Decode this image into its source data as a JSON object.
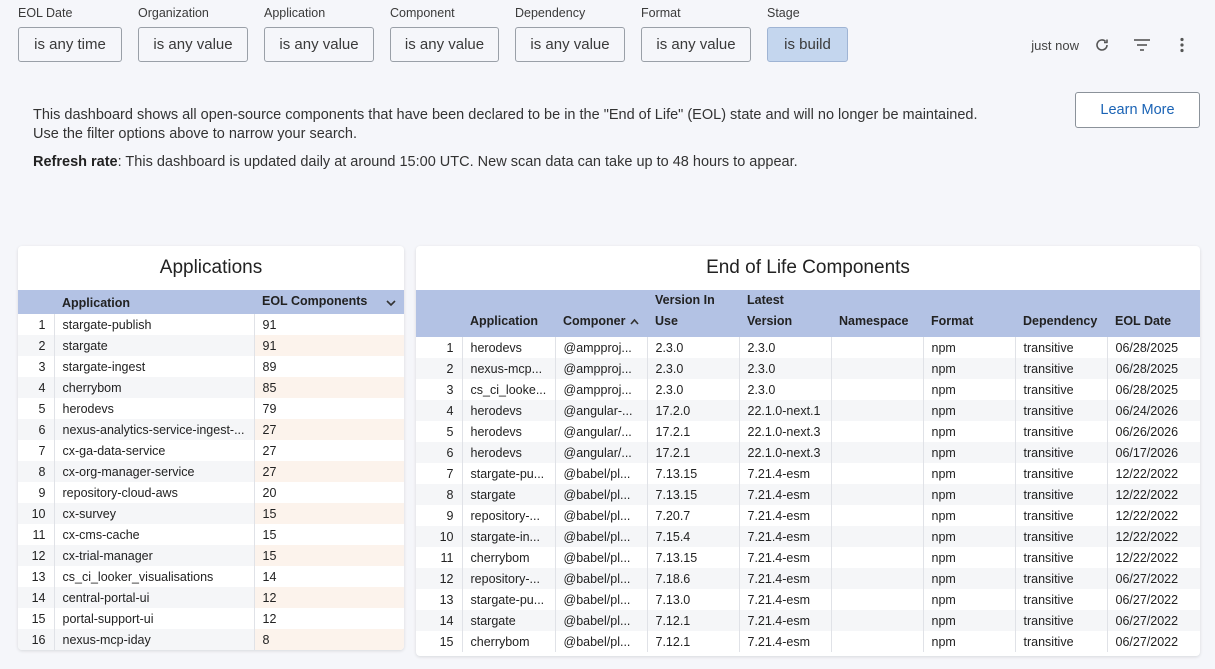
{
  "filters": [
    {
      "label": "EOL Date",
      "value": "is any time"
    },
    {
      "label": "Organization",
      "value": "is any value"
    },
    {
      "label": "Application",
      "value": "is any value"
    },
    {
      "label": "Component",
      "value": "is any value"
    },
    {
      "label": "Dependency",
      "value": "is any value"
    },
    {
      "label": "Format",
      "value": "is any value"
    },
    {
      "label": "Stage",
      "value": "is build"
    }
  ],
  "toolbar": {
    "updated": "just now",
    "refresh_icon": "refresh-icon",
    "filter_icon": "filter-lines-icon",
    "menu_icon": "more-vertical-icon"
  },
  "intro": {
    "line1": "This dashboard shows all open-source components that have been declared to be in the \"End of Life\" (EOL) state and will no longer be maintained.",
    "line2": "Use the filter options above to narrow your search.",
    "refresh_label": "Refresh rate",
    "refresh_text": ": This dashboard is updated daily at around 15:00 UTC. New scan data can take up to 48 hours to appear."
  },
  "learn_more": "Learn More",
  "applications": {
    "title": "Applications",
    "columns": [
      "Application",
      "EOL Components"
    ],
    "rows": [
      [
        "1",
        "stargate-publish",
        "91"
      ],
      [
        "2",
        "stargate",
        "91"
      ],
      [
        "3",
        "stargate-ingest",
        "89"
      ],
      [
        "4",
        "cherrybom",
        "85"
      ],
      [
        "5",
        "herodevs",
        "79"
      ],
      [
        "6",
        "nexus-analytics-service-ingest-...",
        "27"
      ],
      [
        "7",
        "cx-ga-data-service",
        "27"
      ],
      [
        "8",
        "cx-org-manager-service",
        "27"
      ],
      [
        "9",
        "repository-cloud-aws",
        "20"
      ],
      [
        "10",
        "cx-survey",
        "15"
      ],
      [
        "11",
        "cx-cms-cache",
        "15"
      ],
      [
        "12",
        "cx-trial-manager",
        "15"
      ],
      [
        "13",
        "cs_ci_looker_visualisations",
        "14"
      ],
      [
        "14",
        "central-portal-ui",
        "12"
      ],
      [
        "15",
        "portal-support-ui",
        "12"
      ],
      [
        "16",
        "nexus-mcp-iday",
        "8"
      ]
    ]
  },
  "eol": {
    "title": "End of Life Components",
    "columns": [
      "Application",
      "Componer",
      "Version In Use",
      "Latest Version",
      "Namespace",
      "Format",
      "Dependency",
      "EOL Date"
    ],
    "rows": [
      [
        "1",
        "herodevs",
        "@ampproj...",
        "2.3.0",
        "2.3.0",
        "",
        "npm",
        "transitive",
        "06/28/2025"
      ],
      [
        "2",
        "nexus-mcp...",
        "@ampproj...",
        "2.3.0",
        "2.3.0",
        "",
        "npm",
        "transitive",
        "06/28/2025"
      ],
      [
        "3",
        "cs_ci_looke...",
        "@ampproj...",
        "2.3.0",
        "2.3.0",
        "",
        "npm",
        "transitive",
        "06/28/2025"
      ],
      [
        "4",
        "herodevs",
        "@angular-...",
        "17.2.0",
        "22.1.0-next.1",
        "",
        "npm",
        "transitive",
        "06/24/2026"
      ],
      [
        "5",
        "herodevs",
        "@angular/...",
        "17.2.1",
        "22.1.0-next.3",
        "",
        "npm",
        "transitive",
        "06/26/2026"
      ],
      [
        "6",
        "herodevs",
        "@angular/...",
        "17.2.1",
        "22.1.0-next.3",
        "",
        "npm",
        "transitive",
        "06/17/2026"
      ],
      [
        "7",
        "stargate-pu...",
        "@babel/pl...",
        "7.13.15",
        "7.21.4-esm",
        "",
        "npm",
        "transitive",
        "12/22/2022"
      ],
      [
        "8",
        "stargate",
        "@babel/pl...",
        "7.13.15",
        "7.21.4-esm",
        "",
        "npm",
        "transitive",
        "12/22/2022"
      ],
      [
        "9",
        "repository-...",
        "@babel/pl...",
        "7.20.7",
        "7.21.4-esm",
        "",
        "npm",
        "transitive",
        "12/22/2022"
      ],
      [
        "10",
        "stargate-in...",
        "@babel/pl...",
        "7.15.4",
        "7.21.4-esm",
        "",
        "npm",
        "transitive",
        "12/22/2022"
      ],
      [
        "11",
        "cherrybom",
        "@babel/pl...",
        "7.13.15",
        "7.21.4-esm",
        "",
        "npm",
        "transitive",
        "12/22/2022"
      ],
      [
        "12",
        "repository-...",
        "@babel/pl...",
        "7.18.6",
        "7.21.4-esm",
        "",
        "npm",
        "transitive",
        "06/27/2022"
      ],
      [
        "13",
        "stargate-pu...",
        "@babel/pl...",
        "7.13.0",
        "7.21.4-esm",
        "",
        "npm",
        "transitive",
        "06/27/2022"
      ],
      [
        "14",
        "stargate",
        "@babel/pl...",
        "7.12.1",
        "7.21.4-esm",
        "",
        "npm",
        "transitive",
        "06/27/2022"
      ],
      [
        "15",
        "cherrybom",
        "@babel/pl...",
        "7.12.1",
        "7.21.4-esm",
        "",
        "npm",
        "transitive",
        "06/27/2022"
      ]
    ]
  }
}
